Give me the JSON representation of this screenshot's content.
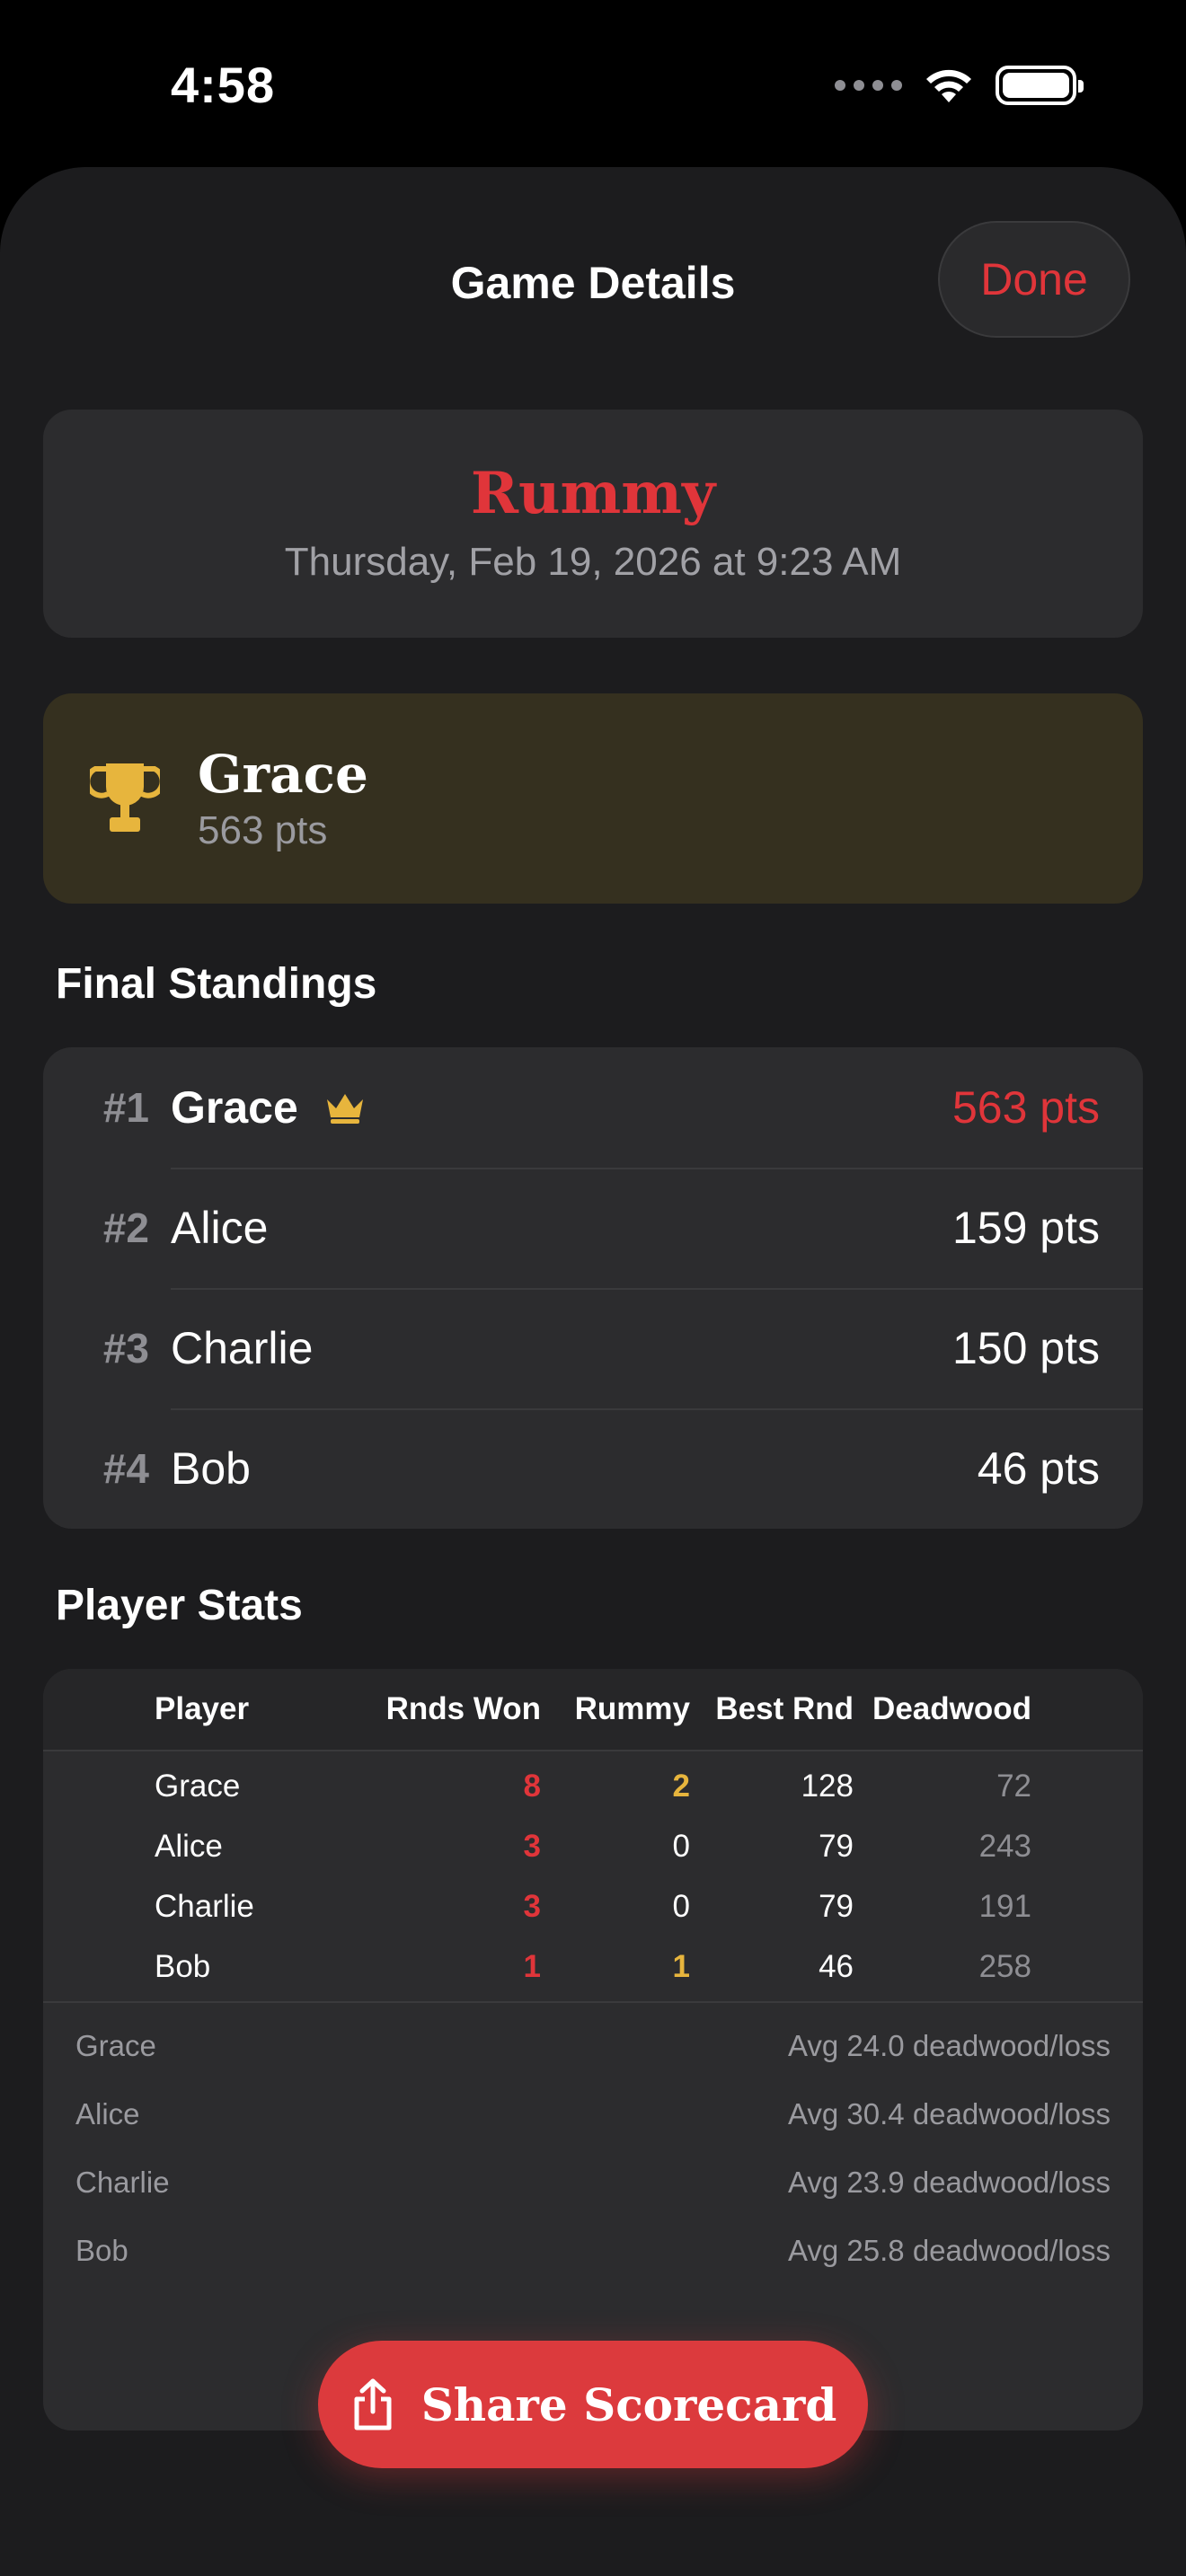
{
  "status_bar": {
    "time": "4:58"
  },
  "nav": {
    "title": "Game Details",
    "done_label": "Done"
  },
  "game": {
    "name": "Rummy",
    "date": "Thursday, Feb 19, 2026 at 9:23 AM"
  },
  "winner": {
    "name": "Grace",
    "points": "563 pts"
  },
  "final_standings": {
    "title": "Final Standings",
    "rows": [
      {
        "rank": "#1",
        "name": "Grace",
        "points": "563 pts"
      },
      {
        "rank": "#2",
        "name": "Alice",
        "points": "159 pts"
      },
      {
        "rank": "#3",
        "name": "Charlie",
        "points": "150 pts"
      },
      {
        "rank": "#4",
        "name": "Bob",
        "points": "46 pts"
      }
    ]
  },
  "player_stats": {
    "title": "Player Stats",
    "columns": [
      "Player",
      "Rnds Won",
      "Rummy",
      "Best Rnd",
      "Deadwood"
    ],
    "rows": [
      {
        "player": "Grace",
        "rounds_won": "8",
        "rummy": "2",
        "best_round": "128",
        "deadwood": "72"
      },
      {
        "player": "Alice",
        "rounds_won": "3",
        "rummy": "0",
        "best_round": "79",
        "deadwood": "243"
      },
      {
        "player": "Charlie",
        "rounds_won": "3",
        "rummy": "0",
        "best_round": "79",
        "deadwood": "191"
      },
      {
        "player": "Bob",
        "rounds_won": "1",
        "rummy": "1",
        "best_round": "46",
        "deadwood": "258"
      }
    ],
    "averages": [
      {
        "player": "Grace",
        "text": "Avg 24.0 deadwood/loss"
      },
      {
        "player": "Alice",
        "text": "Avg 30.4 deadwood/loss"
      },
      {
        "player": "Charlie",
        "text": "Avg 23.9 deadwood/loss"
      },
      {
        "player": "Bob",
        "text": "Avg 25.8 deadwood/loss"
      }
    ]
  },
  "share": {
    "label": "Share Scorecard"
  },
  "colors": {
    "accent": "#e0353a",
    "gold": "#e7b53d",
    "sheet": "#1c1c1e",
    "card": "#2c2c2e"
  }
}
